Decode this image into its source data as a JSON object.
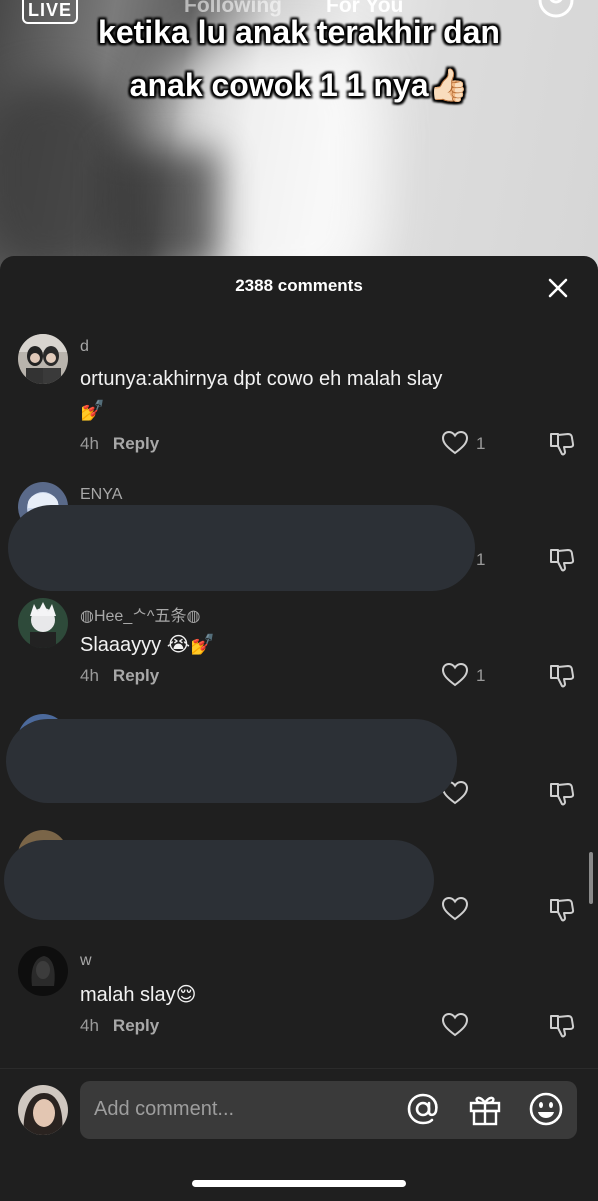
{
  "video": {
    "live_label": "LIVE",
    "tabs": [
      "Following",
      "For You"
    ],
    "caption_line1": "ketika lu anak terakhir dan",
    "caption_line2": "anak cowok 1 1 nya👍🏻"
  },
  "comments_panel": {
    "title": "2388 comments",
    "comments": [
      {
        "username": "d",
        "text_line1": "ortunya:akhirnya dpt cowo eh malah slay",
        "text_line2": "💅",
        "time": "4h",
        "reply_label": "Reply",
        "likes": "1"
      },
      {
        "username": "ENYA",
        "likes": "1"
      },
      {
        "username": "◍Hee_ᄉ^五条◍",
        "text_line1": "Slaaayyy 😭💅",
        "time": "4h",
        "reply_label": "Reply",
        "likes": "1"
      },
      {
        "username": ""
      },
      {
        "username": ""
      },
      {
        "username": "w",
        "text_line1": "malah slay😌",
        "time": "4h",
        "reply_label": "Reply"
      }
    ]
  },
  "composer": {
    "placeholder": "Add comment...",
    "icons": [
      "at-icon",
      "gift-icon",
      "emoji-icon"
    ]
  },
  "colors": {
    "panel_bg": "#1f1f1f",
    "input_bg": "#3a3a3a",
    "redaction": "#2c3036",
    "muted_text": "#9a9a9a"
  }
}
